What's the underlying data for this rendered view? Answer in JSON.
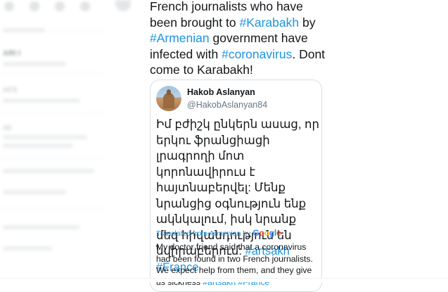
{
  "tweet": {
    "text_parts": [
      {
        "text": "French journalists who have been brought to ",
        "tag": false
      },
      {
        "text": "#Karabakh",
        "tag": true
      },
      {
        "text": " by ",
        "tag": false
      },
      {
        "text": "#Armenian",
        "tag": true
      },
      {
        "text": " government have infected with ",
        "tag": false
      },
      {
        "text": "#coronavirus",
        "tag": true
      },
      {
        "text": ". Dont come to Karabakh!",
        "tag": false
      }
    ]
  },
  "quoted": {
    "name": "Hakob Aslanyan",
    "handle": "@HakobAslanyan84",
    "avatar_icon": "church-landscape-avatar",
    "body_text": "Իմ բժիշկ ընկերն ասաց, որ երկու ֆրանցիացի լրագրողի մոտ կորոնավիրուս է հայտնաբերվել: Մենք նրանցից օգնություն ենք ակնկալում, իսկ նրանք մեզ հիվանդություն են նվիրաբերում:",
    "body_tags": [
      "#artsakh",
      "#France"
    ],
    "translated_label": "Translated from Armenian",
    "translated_by": "by",
    "google_logo": "Google",
    "translation_text": "My doctor friend said that a coronavirus had been found in two French journalists. We expect help from them, and they give us sickness",
    "translation_tags": "#artsakh #France"
  },
  "colors": {
    "link": "#1b95e0",
    "text": "#14171a",
    "muted": "#657786",
    "border": "#d9dee2"
  },
  "left_column": {
    "labels": [
      "ARI I",
      "AFA",
      "Ali"
    ]
  }
}
